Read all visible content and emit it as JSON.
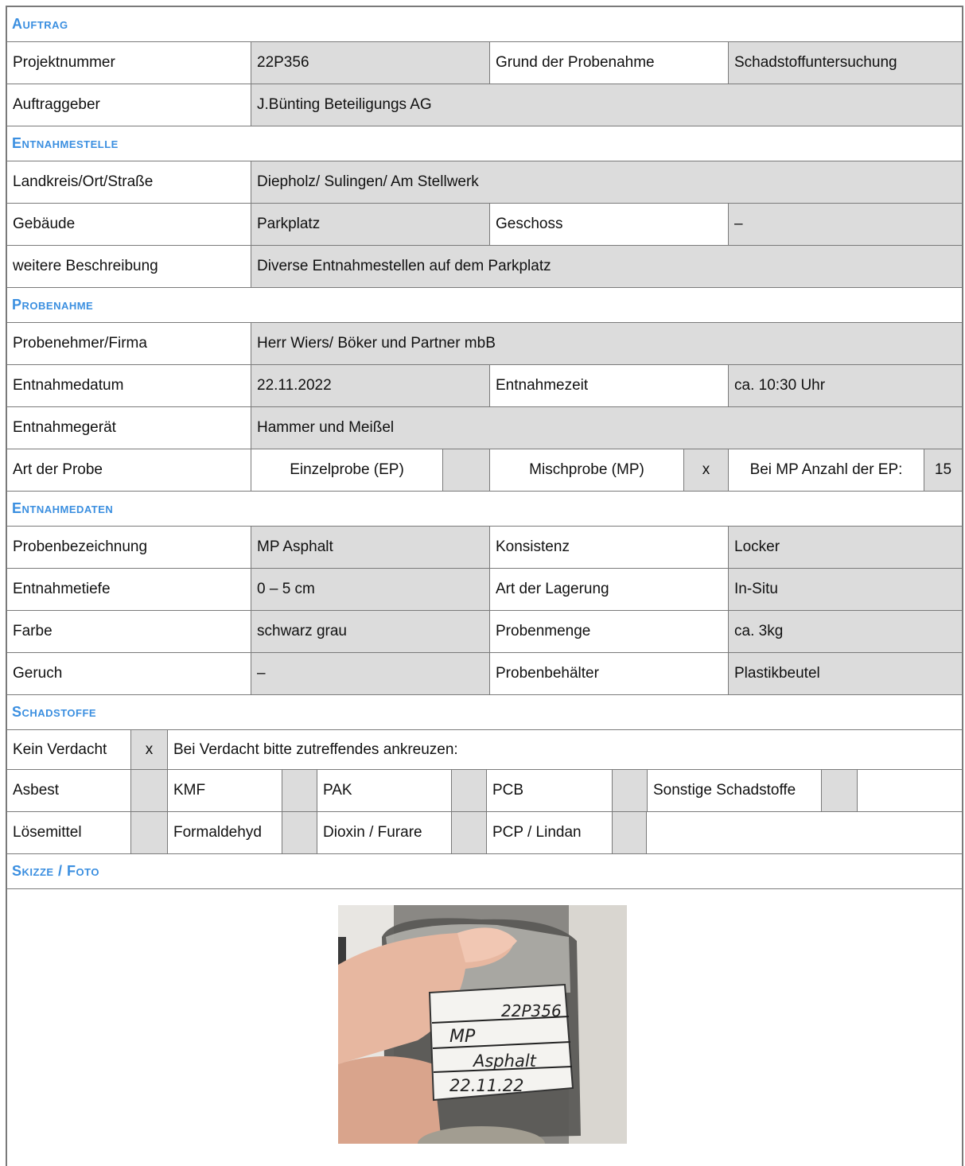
{
  "sections": {
    "auftrag": "Auftrag",
    "entnahmestelle": "Entnahmestelle",
    "probenahme": "Probenahme",
    "entnahmedaten": "Entnahmedaten",
    "schadstoffe": "Schadstoffe",
    "skizze": "Skizze / Foto"
  },
  "auftrag": {
    "projektnummer_label": "Projektnummer",
    "projektnummer": "22P356",
    "grund_label": "Grund der Probenahme",
    "grund": "Schadstoffuntersuchung",
    "auftraggeber_label": "Auftraggeber",
    "auftraggeber": "J.Bünting Beteiligungs AG"
  },
  "entnahmestelle": {
    "ort_label": "Landkreis/Ort/Straße",
    "ort": "Diepholz/ Sulingen/ Am Stellwerk",
    "gebaeude_label": "Gebäude",
    "gebaeude": "Parkplatz",
    "geschoss_label": "Geschoss",
    "geschoss": "–",
    "beschreibung_label": "weitere Beschreibung",
    "beschreibung": "Diverse Entnahmestellen auf dem Parkplatz"
  },
  "probenahme": {
    "nehmer_label": "Probenehmer/Firma",
    "nehmer": "Herr Wiers/ Böker und Partner mbB",
    "datum_label": "Entnahmedatum",
    "datum": "22.11.2022",
    "zeit_label": "Entnahmezeit",
    "zeit": "ca. 10:30 Uhr",
    "geraet_label": "Entnahmegerät",
    "geraet": "Hammer und Meißel",
    "art_label": "Art der Probe",
    "einzel_label": "Einzelprobe (EP)",
    "einzel_mark": "",
    "misch_label": "Mischprobe (MP)",
    "misch_mark": "x",
    "anzahl_label": "Bei MP Anzahl der EP:",
    "anzahl": "15"
  },
  "entnahmedaten": {
    "bez_label": "Probenbezeichnung",
    "bez": "MP Asphalt",
    "konsistenz_label": "Konsistenz",
    "konsistenz": "Locker",
    "tiefe_label": "Entnahmetiefe",
    "tiefe": "0 – 5 cm",
    "lagerung_label": "Art der Lagerung",
    "lagerung": "In-Situ",
    "farbe_label": "Farbe",
    "farbe": "schwarz grau",
    "menge_label": "Probenmenge",
    "menge": "ca. 3kg",
    "geruch_label": "Geruch",
    "geruch": "–",
    "behaelter_label": "Probenbehälter",
    "behaelter": "Plastikbeutel"
  },
  "schadstoffe": {
    "kein_label": "Kein Verdacht",
    "kein_mark": "x",
    "hint": "Bei Verdacht bitte zutreffendes ankreuzen:",
    "asbest": "Asbest",
    "kmf": "KMF",
    "pak": "PAK",
    "pcb": "PCB",
    "sonstige": "Sonstige Schadstoffe",
    "loesemittel": "Lösemittel",
    "formaldehyd": "Formaldehyd",
    "dioxin": "Dioxin / Furare",
    "pcp": "PCP / Lindan"
  },
  "photo": {
    "label_lines": [
      "22P356",
      "MP",
      "Asphalt",
      "22.11.22"
    ]
  }
}
